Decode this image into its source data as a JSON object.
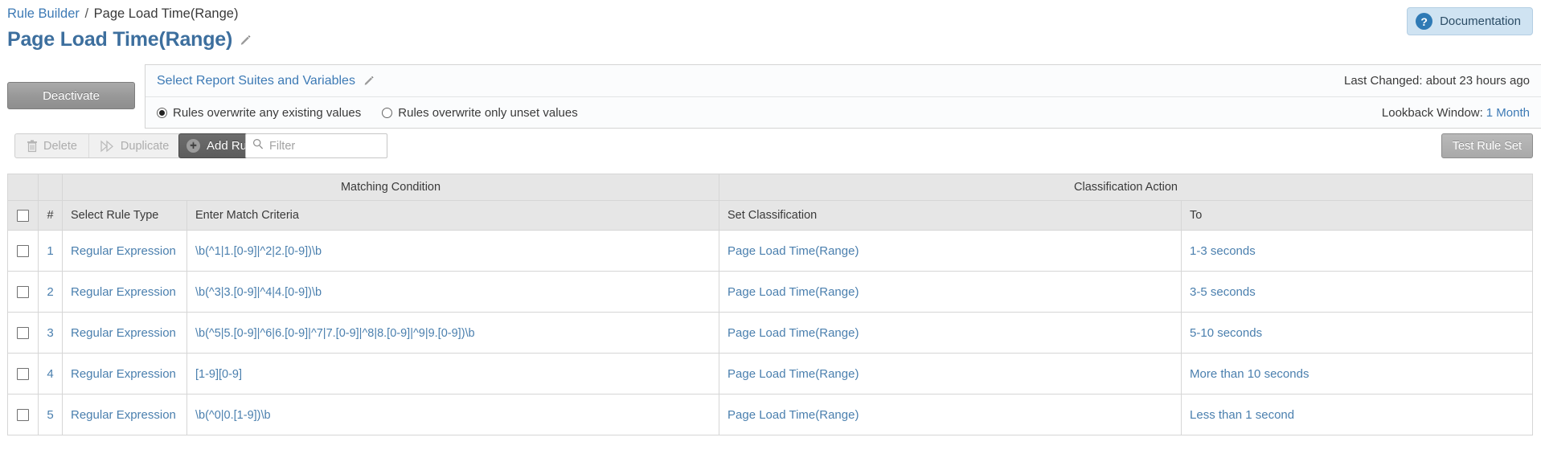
{
  "breadcrumb": {
    "root": "Rule Builder",
    "separator": "/",
    "current": "Page Load Time(Range)"
  },
  "page": {
    "title": "Page Load Time(Range)",
    "edit_icon": "pencil-icon"
  },
  "documentation": {
    "label": "Documentation",
    "icon": "question-mark-icon",
    "bg_color": "#cfe3f2",
    "icon_color": "#2f7ab5"
  },
  "actions": {
    "deactivate_label": "Deactivate"
  },
  "settings": {
    "report_suites_label": "Select Report Suites and Variables",
    "report_suites_edit_icon": "pencil-icon",
    "overwrite_options": [
      {
        "label": "Rules overwrite any existing values",
        "selected": true
      },
      {
        "label": "Rules overwrite only unset values",
        "selected": false
      }
    ],
    "last_changed_label": "Last Changed: about 23 hours ago",
    "lookback_label": "Lookback Window:",
    "lookback_value": "1 Month"
  },
  "toolbar": {
    "delete_label": "Delete",
    "delete_icon": "trash-icon",
    "duplicate_label": "Duplicate",
    "duplicate_icon": "duplicate-icon",
    "add_rule_label": "Add Rule",
    "add_rule_icon": "plus-circle-icon",
    "filter_placeholder": "Filter",
    "filter_value": "",
    "filter_icon": "search-icon",
    "test_rule_set_label": "Test Rule Set"
  },
  "table": {
    "group_headers": {
      "matching_condition": "Matching Condition",
      "classification_action": "Classification Action"
    },
    "columns": {
      "num": "#",
      "rule_type": "Select Rule Type",
      "match_criteria": "Enter Match Criteria",
      "set_classification": "Set Classification",
      "to": "To"
    },
    "rows": [
      {
        "num": "1",
        "rule_type": "Regular Expression",
        "match_criteria": "\\b(^1|1.[0-9]|^2|2.[0-9])\\b",
        "set_classification": "Page Load Time(Range)",
        "to": "1-3 seconds",
        "checked": false
      },
      {
        "num": "2",
        "rule_type": "Regular Expression",
        "match_criteria": "\\b(^3|3.[0-9]|^4|4.[0-9])\\b",
        "set_classification": "Page Load Time(Range)",
        "to": "3-5 seconds",
        "checked": false
      },
      {
        "num": "3",
        "rule_type": "Regular Expression",
        "match_criteria": "\\b(^5|5.[0-9]|^6|6.[0-9]|^7|7.[0-9]|^8|8.[0-9]|^9|9.[0-9])\\b",
        "set_classification": "Page Load Time(Range)",
        "to": "5-10 seconds",
        "checked": false
      },
      {
        "num": "4",
        "rule_type": "Regular Expression",
        "match_criteria": "[1-9][0-9]",
        "set_classification": "Page Load Time(Range)",
        "to": "More than 10 seconds",
        "checked": false
      },
      {
        "num": "5",
        "rule_type": "Regular Expression",
        "match_criteria": "\\b(^0|0.[1-9])\\b",
        "set_classification": "Page Load Time(Range)",
        "to": "Less than 1 second",
        "checked": false
      }
    ]
  },
  "colors": {
    "link": "#3d7ab5",
    "title": "#3d6f9e",
    "header_bg": "#e6e6e6"
  }
}
